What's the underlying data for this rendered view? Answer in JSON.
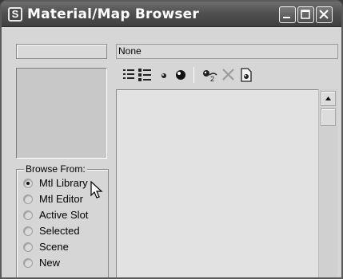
{
  "window": {
    "title": "Material/Map Browser"
  },
  "name_field": {
    "value": ""
  },
  "selected": {
    "value": "None"
  },
  "toolbar": {
    "items": [
      "view-list-icon",
      "view-list-icons-icon",
      "small-icons-icon",
      "large-icons-icon",
      "update-scene-materials-icon",
      "delete-icon",
      "clear-material-library-icon"
    ]
  },
  "browse_from": {
    "label": "Browse From:",
    "options": [
      {
        "label": "Mtl Library",
        "checked": true
      },
      {
        "label": "Mtl Editor",
        "checked": false
      },
      {
        "label": "Active Slot",
        "checked": false
      },
      {
        "label": "Selected",
        "checked": false
      },
      {
        "label": "Scene",
        "checked": false
      },
      {
        "label": "New",
        "checked": false
      }
    ]
  }
}
